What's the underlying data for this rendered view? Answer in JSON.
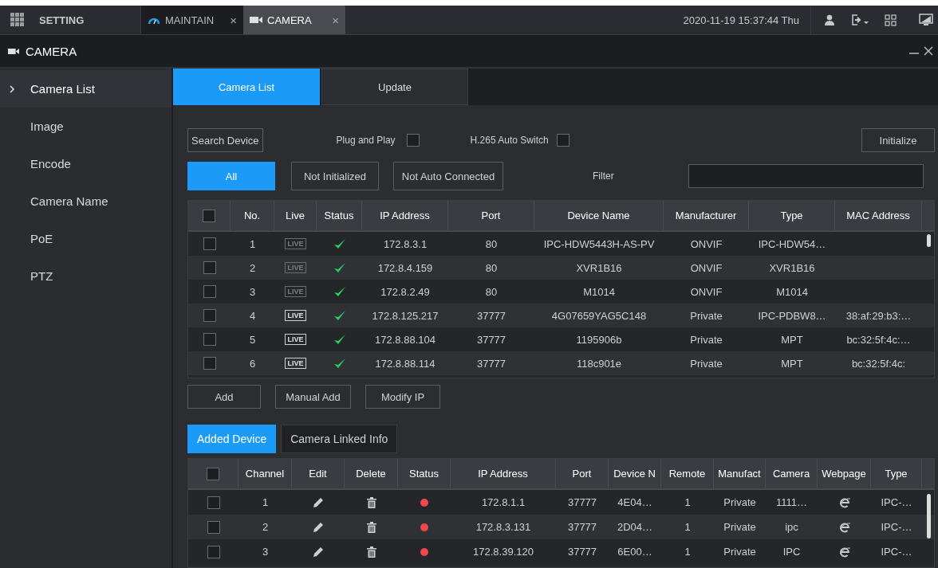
{
  "top_bar": {
    "menu": {
      "label": "SETTING"
    },
    "tabs": [
      {
        "label": "MAINTAIN",
        "close": "×",
        "selected": false,
        "kind": "gauge"
      },
      {
        "label": "CAMERA",
        "close": "×",
        "selected": true,
        "kind": "camera"
      }
    ],
    "datetime": "2020-11-19 15:37:44 Thu"
  },
  "panel": {
    "title": "CAMERA"
  },
  "sidebar": {
    "items": [
      {
        "label": "Camera List",
        "selected": true
      },
      {
        "label": "Image",
        "selected": false
      },
      {
        "label": "Encode",
        "selected": false
      },
      {
        "label": "Camera Name",
        "selected": false
      },
      {
        "label": "PoE",
        "selected": false
      },
      {
        "label": "PTZ",
        "selected": false
      }
    ]
  },
  "tabs": [
    {
      "label": "Camera List",
      "selected": true
    },
    {
      "label": "Update",
      "selected": false
    }
  ],
  "search_button": "Search Device",
  "plug_and_play": {
    "label": "Plug and Play",
    "checked": false
  },
  "h265_auto_switch": {
    "label": "H.265 Auto Switch",
    "checked": false
  },
  "initialize_button": "Initialize",
  "filters": [
    {
      "label": "All",
      "selected": true
    },
    {
      "label": "Not Initialized",
      "selected": false
    },
    {
      "label": "Not Auto Connected",
      "selected": false
    }
  ],
  "filter": {
    "label": "Filter"
  },
  "device_table": {
    "select_all": {
      "checked": false
    },
    "columns": [
      "No.",
      "Live",
      "Status",
      "IP Address",
      "Port",
      "Device Name",
      "Manufacturer",
      "Type",
      "MAC Address"
    ],
    "rows": [
      {
        "checked": false,
        "no": "1",
        "live": "LIVE",
        "live_enabled": false,
        "online": true,
        "ip": "172.8.3.1",
        "port": "80",
        "device_name": "IPC-HDW5443H-AS-PV",
        "manufacturer": "ONVIF",
        "type": "IPC-HDW54…",
        "mac": ""
      },
      {
        "checked": false,
        "no": "2",
        "live": "LIVE",
        "live_enabled": false,
        "online": true,
        "ip": "172.8.4.159",
        "port": "80",
        "device_name": "XVR1B16",
        "manufacturer": "ONVIF",
        "type": "XVR1B16",
        "mac": ""
      },
      {
        "checked": false,
        "no": "3",
        "live": "LIVE",
        "live_enabled": false,
        "online": true,
        "ip": "172.8.2.49",
        "port": "80",
        "device_name": "M1014",
        "manufacturer": "ONVIF",
        "type": "M1014",
        "mac": ""
      },
      {
        "checked": false,
        "no": "4",
        "live": "LIVE",
        "live_enabled": true,
        "online": true,
        "ip": "172.8.125.217",
        "port": "37777",
        "device_name": "4G07659YAG5C148",
        "manufacturer": "Private",
        "type": "IPC-PDBW8…",
        "mac": "38:af:29:b3:…"
      },
      {
        "checked": false,
        "no": "5",
        "live": "LIVE",
        "live_enabled": true,
        "online": true,
        "ip": "172.8.88.104",
        "port": "37777",
        "device_name": "1195906b",
        "manufacturer": "Private",
        "type": "MPT",
        "mac": "bc:32:5f:4c:…"
      },
      {
        "checked": false,
        "no": "6",
        "live": "LIVE",
        "live_enabled": true,
        "online": true,
        "ip": "172.8.88.114",
        "port": "37777",
        "device_name": "118c901e",
        "manufacturer": "Private",
        "type": "MPT",
        "mac": "bc:32:5f:4c:"
      }
    ]
  },
  "actions": [
    "Add",
    "Manual Add",
    "Modify IP"
  ],
  "lower_tabs": [
    {
      "label": "Added Device",
      "selected": true
    },
    {
      "label": "Camera Linked Info",
      "selected": false
    }
  ],
  "added_table": {
    "select_all": {
      "checked": false
    },
    "columns": [
      "Channel",
      "Edit",
      "Delete",
      "Status",
      "IP Address",
      "Port",
      "Device N",
      "Remote",
      "Manufact",
      "Camera",
      "Webpage",
      "Type"
    ],
    "rows": [
      {
        "checked": false,
        "channel": "1",
        "online": false,
        "ip": "172.8.1.1",
        "port": "37777",
        "device_name": "4E04…",
        "remote_channel": "1",
        "manufacturer": "Private",
        "camera_name": "1111…",
        "type": "IPC-…"
      },
      {
        "checked": false,
        "channel": "2",
        "online": false,
        "ip": "172.8.3.131",
        "port": "37777",
        "device_name": "2D04…",
        "remote_channel": "1",
        "manufacturer": "Private",
        "camera_name": "ipc",
        "type": "IPC-…"
      },
      {
        "checked": false,
        "channel": "3",
        "online": false,
        "ip": "172.8.39.120",
        "port": "37777",
        "device_name": "6E00…",
        "remote_channel": "1",
        "manufacturer": "Private",
        "camera_name": "IPC",
        "type": "IPC-…"
      }
    ]
  }
}
